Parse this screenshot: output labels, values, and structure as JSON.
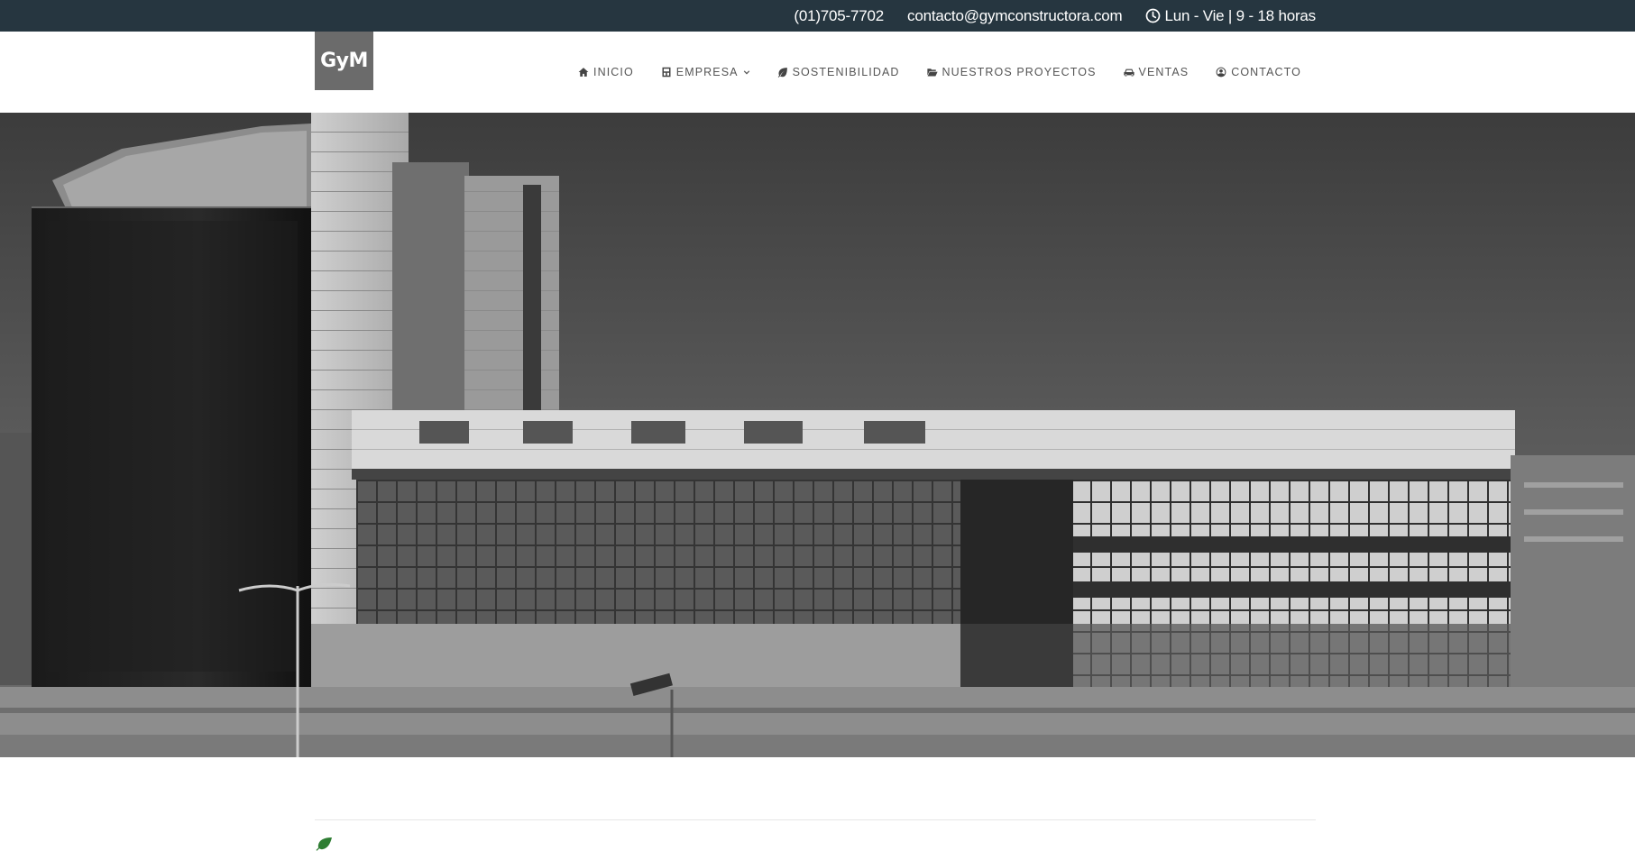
{
  "topbar": {
    "phone": "(01)705-7702",
    "email": "contacto@gymconstructora.com",
    "hours": "Lun - Vie | 9 - 18 horas",
    "hours_icon": "clock-icon"
  },
  "header": {
    "logo_text": "GyM",
    "nav": [
      {
        "label": "INICIO",
        "icon": "home-icon"
      },
      {
        "label": "EMPRESA",
        "icon": "building-icon",
        "has_dropdown": true
      },
      {
        "label": "SOSTENIBILIDAD",
        "icon": "leaf-icon"
      },
      {
        "label": "NUESTROS PROYECTOS",
        "icon": "folder-open-icon"
      },
      {
        "label": "VENTAS",
        "icon": "car-icon"
      },
      {
        "label": "CONTACTO",
        "icon": "user-circle-icon"
      }
    ]
  },
  "hero": {
    "image": "black-and-white-photo-of-office-buildings"
  },
  "content": {
    "intro_icon": "leaf-icon"
  },
  "colors": {
    "topbar_bg": "#263640",
    "nav_text": "#555555",
    "logo_bg": "#6b6b6b",
    "leaf_green": "#2e7d32"
  }
}
